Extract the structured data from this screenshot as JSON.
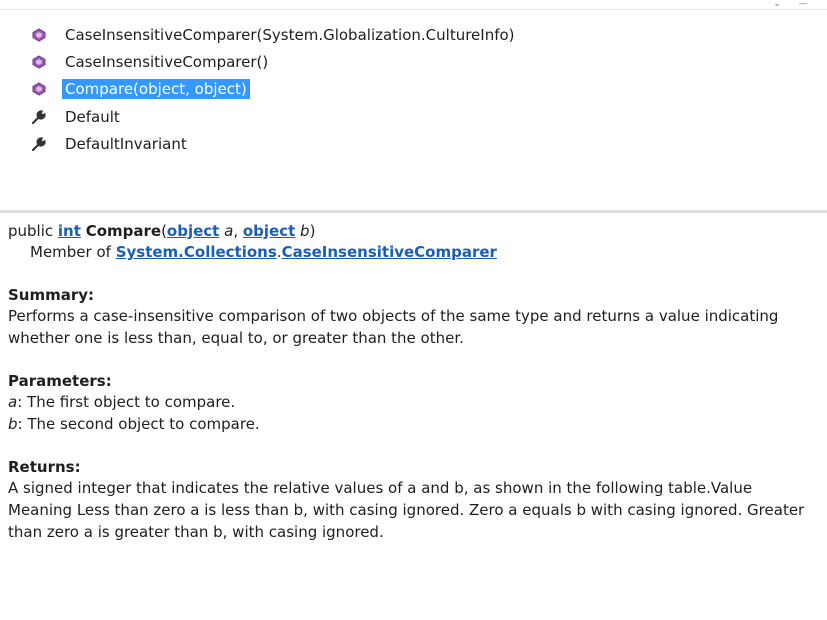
{
  "top_bar": {
    "scroll_down_glyph": "⌄",
    "scroll_end_glyph": "—"
  },
  "member_list": {
    "items": [
      {
        "label": "CaseInsensitiveComparer(System.Globalization.CultureInfo)",
        "icon": "method-icon",
        "selected": false
      },
      {
        "label": "CaseInsensitiveComparer()",
        "icon": "method-icon",
        "selected": false
      },
      {
        "label": "Compare(object, object)",
        "icon": "method-icon",
        "selected": true
      },
      {
        "label": "Default",
        "icon": "property-wrench-icon",
        "selected": false
      },
      {
        "label": "DefaultInvariant",
        "icon": "property-wrench-icon",
        "selected": false
      }
    ],
    "selection_color": "#3399ff",
    "method_icon_color": "#8e44ad"
  },
  "tooltip": {
    "signature": {
      "modifier": "public ",
      "return_type": "int",
      "method_name": "Compare",
      "open_paren": "(",
      "param1_type": "object",
      "param1_name": " a",
      "comma": ", ",
      "param2_type": "object",
      "param2_name": " b",
      "close_paren": ")"
    },
    "member_of": {
      "prefix": "Member of ",
      "namespace_link": "System.Collections",
      "dot": ".",
      "class_link": "CaseInsensitiveComparer"
    },
    "summary": {
      "title": "Summary:",
      "text": "Performs a case-insensitive comparison of two objects of the same type and returns a value indicating whether one is less than, equal to, or greater than the other."
    },
    "parameters": {
      "title": "Parameters:",
      "items": [
        {
          "name": "a",
          "desc": ": The first object to compare."
        },
        {
          "name": "b",
          "desc": ": The second object to compare."
        }
      ]
    },
    "returns": {
      "title": "Returns:",
      "text": "A signed integer that indicates the relative values of a and b, as shown in the following table.Value Meaning Less than zero a is less than b, with casing ignored. Zero a equals b with casing ignored. Greater than zero a is greater than b, with casing ignored."
    },
    "link_color": "#1a5fb4"
  }
}
